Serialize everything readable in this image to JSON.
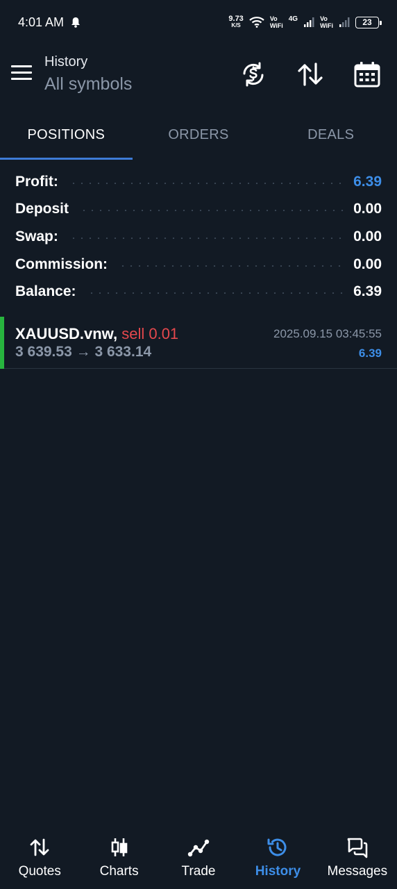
{
  "status_bar": {
    "time": "4:01 AM",
    "net_speed_value": "9.73",
    "net_speed_unit": "K/S",
    "vowifi_1_top": "Vo",
    "vowifi_1_bottom": "WiFi",
    "network_type": "4G",
    "vowifi_2_top": "Vo",
    "vowifi_2_bottom": "WiFi",
    "battery": "23"
  },
  "app_bar": {
    "title": "History",
    "subtitle": "All symbols",
    "icons": [
      "menu-icon",
      "sync-currency-icon",
      "sort-icon",
      "calendar-icon"
    ]
  },
  "tabs": [
    {
      "label": "POSITIONS",
      "active": true
    },
    {
      "label": "ORDERS",
      "active": false
    },
    {
      "label": "DEALS",
      "active": false
    }
  ],
  "summary": [
    {
      "label": "Profit:",
      "value": "6.39",
      "highlight": true
    },
    {
      "label": "Deposit",
      "value": "0.00",
      "highlight": false
    },
    {
      "label": "Swap:",
      "value": "0.00",
      "highlight": false
    },
    {
      "label": "Commission:",
      "value": "0.00",
      "highlight": false
    },
    {
      "label": "Balance:",
      "value": "6.39",
      "highlight": false
    }
  ],
  "positions": [
    {
      "symbol": "XAUUSD.vnw,",
      "side": "sell 0.01",
      "open_price": "3 639.53",
      "arrow": "→",
      "close_price": "3 633.14",
      "time": "2025.09.15 03:45:55",
      "profit": "6.39"
    }
  ],
  "bottom_nav": [
    {
      "label": "Quotes",
      "icon": "quotes-icon",
      "active": false
    },
    {
      "label": "Charts",
      "icon": "charts-icon",
      "active": false
    },
    {
      "label": "Trade",
      "icon": "trade-icon",
      "active": false
    },
    {
      "label": "History",
      "icon": "history-icon",
      "active": true
    },
    {
      "label": "Messages",
      "icon": "messages-icon",
      "active": false
    }
  ],
  "colors": {
    "background": "#121a24",
    "accent_blue": "#3d8ee8",
    "sell_red": "#e5484d",
    "position_marker_green": "#27b43e",
    "muted_text": "#8b97a8"
  }
}
